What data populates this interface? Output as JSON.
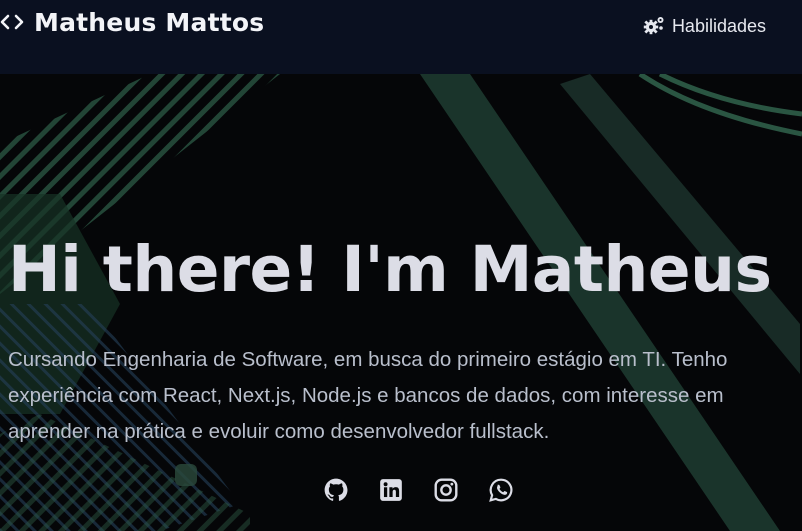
{
  "header": {
    "brand_name": "Matheus Mattos",
    "brand_icon": "code-brackets-icon",
    "nav": {
      "skills_label": "Habilidades",
      "skills_icon": "gears-icon"
    }
  },
  "hero": {
    "title": "Hi there! I'm Matheus",
    "description": "Cursando Engenharia de Software, em busca do primeiro estágio em TI. Tenho experiência com React, Next.js, Node.js e bancos de dados, com interesse em aprender na prática e evoluir como desenvolvedor fullstack.",
    "socials": [
      {
        "name": "GitHub",
        "icon": "github-icon"
      },
      {
        "name": "LinkedIn",
        "icon": "linkedin-icon"
      },
      {
        "name": "Instagram",
        "icon": "instagram-icon"
      },
      {
        "name": "WhatsApp",
        "icon": "whatsapp-icon"
      }
    ]
  },
  "colors": {
    "header_bg": "#0a1020",
    "page_bg": "#050608",
    "accent_green": "#2f5e48",
    "text": "#dcdde6"
  }
}
